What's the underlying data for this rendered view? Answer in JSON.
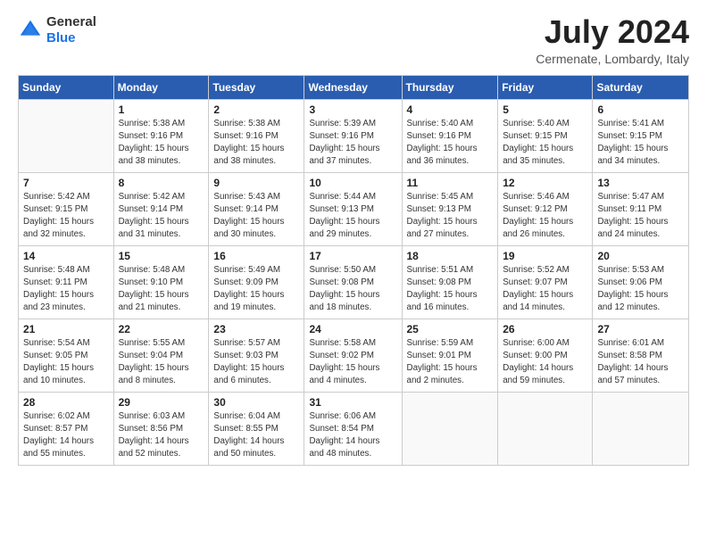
{
  "header": {
    "logo_line1": "General",
    "logo_line2": "Blue",
    "month": "July 2024",
    "location": "Cermenate, Lombardy, Italy"
  },
  "weekdays": [
    "Sunday",
    "Monday",
    "Tuesday",
    "Wednesday",
    "Thursday",
    "Friday",
    "Saturday"
  ],
  "weeks": [
    [
      {
        "day": "",
        "info": ""
      },
      {
        "day": "1",
        "info": "Sunrise: 5:38 AM\nSunset: 9:16 PM\nDaylight: 15 hours\nand 38 minutes."
      },
      {
        "day": "2",
        "info": "Sunrise: 5:38 AM\nSunset: 9:16 PM\nDaylight: 15 hours\nand 38 minutes."
      },
      {
        "day": "3",
        "info": "Sunrise: 5:39 AM\nSunset: 9:16 PM\nDaylight: 15 hours\nand 37 minutes."
      },
      {
        "day": "4",
        "info": "Sunrise: 5:40 AM\nSunset: 9:16 PM\nDaylight: 15 hours\nand 36 minutes."
      },
      {
        "day": "5",
        "info": "Sunrise: 5:40 AM\nSunset: 9:15 PM\nDaylight: 15 hours\nand 35 minutes."
      },
      {
        "day": "6",
        "info": "Sunrise: 5:41 AM\nSunset: 9:15 PM\nDaylight: 15 hours\nand 34 minutes."
      }
    ],
    [
      {
        "day": "7",
        "info": "Sunrise: 5:42 AM\nSunset: 9:15 PM\nDaylight: 15 hours\nand 32 minutes."
      },
      {
        "day": "8",
        "info": "Sunrise: 5:42 AM\nSunset: 9:14 PM\nDaylight: 15 hours\nand 31 minutes."
      },
      {
        "day": "9",
        "info": "Sunrise: 5:43 AM\nSunset: 9:14 PM\nDaylight: 15 hours\nand 30 minutes."
      },
      {
        "day": "10",
        "info": "Sunrise: 5:44 AM\nSunset: 9:13 PM\nDaylight: 15 hours\nand 29 minutes."
      },
      {
        "day": "11",
        "info": "Sunrise: 5:45 AM\nSunset: 9:13 PM\nDaylight: 15 hours\nand 27 minutes."
      },
      {
        "day": "12",
        "info": "Sunrise: 5:46 AM\nSunset: 9:12 PM\nDaylight: 15 hours\nand 26 minutes."
      },
      {
        "day": "13",
        "info": "Sunrise: 5:47 AM\nSunset: 9:11 PM\nDaylight: 15 hours\nand 24 minutes."
      }
    ],
    [
      {
        "day": "14",
        "info": "Sunrise: 5:48 AM\nSunset: 9:11 PM\nDaylight: 15 hours\nand 23 minutes."
      },
      {
        "day": "15",
        "info": "Sunrise: 5:48 AM\nSunset: 9:10 PM\nDaylight: 15 hours\nand 21 minutes."
      },
      {
        "day": "16",
        "info": "Sunrise: 5:49 AM\nSunset: 9:09 PM\nDaylight: 15 hours\nand 19 minutes."
      },
      {
        "day": "17",
        "info": "Sunrise: 5:50 AM\nSunset: 9:08 PM\nDaylight: 15 hours\nand 18 minutes."
      },
      {
        "day": "18",
        "info": "Sunrise: 5:51 AM\nSunset: 9:08 PM\nDaylight: 15 hours\nand 16 minutes."
      },
      {
        "day": "19",
        "info": "Sunrise: 5:52 AM\nSunset: 9:07 PM\nDaylight: 15 hours\nand 14 minutes."
      },
      {
        "day": "20",
        "info": "Sunrise: 5:53 AM\nSunset: 9:06 PM\nDaylight: 15 hours\nand 12 minutes."
      }
    ],
    [
      {
        "day": "21",
        "info": "Sunrise: 5:54 AM\nSunset: 9:05 PM\nDaylight: 15 hours\nand 10 minutes."
      },
      {
        "day": "22",
        "info": "Sunrise: 5:55 AM\nSunset: 9:04 PM\nDaylight: 15 hours\nand 8 minutes."
      },
      {
        "day": "23",
        "info": "Sunrise: 5:57 AM\nSunset: 9:03 PM\nDaylight: 15 hours\nand 6 minutes."
      },
      {
        "day": "24",
        "info": "Sunrise: 5:58 AM\nSunset: 9:02 PM\nDaylight: 15 hours\nand 4 minutes."
      },
      {
        "day": "25",
        "info": "Sunrise: 5:59 AM\nSunset: 9:01 PM\nDaylight: 15 hours\nand 2 minutes."
      },
      {
        "day": "26",
        "info": "Sunrise: 6:00 AM\nSunset: 9:00 PM\nDaylight: 14 hours\nand 59 minutes."
      },
      {
        "day": "27",
        "info": "Sunrise: 6:01 AM\nSunset: 8:58 PM\nDaylight: 14 hours\nand 57 minutes."
      }
    ],
    [
      {
        "day": "28",
        "info": "Sunrise: 6:02 AM\nSunset: 8:57 PM\nDaylight: 14 hours\nand 55 minutes."
      },
      {
        "day": "29",
        "info": "Sunrise: 6:03 AM\nSunset: 8:56 PM\nDaylight: 14 hours\nand 52 minutes."
      },
      {
        "day": "30",
        "info": "Sunrise: 6:04 AM\nSunset: 8:55 PM\nDaylight: 14 hours\nand 50 minutes."
      },
      {
        "day": "31",
        "info": "Sunrise: 6:06 AM\nSunset: 8:54 PM\nDaylight: 14 hours\nand 48 minutes."
      },
      {
        "day": "",
        "info": ""
      },
      {
        "day": "",
        "info": ""
      },
      {
        "day": "",
        "info": ""
      }
    ]
  ]
}
